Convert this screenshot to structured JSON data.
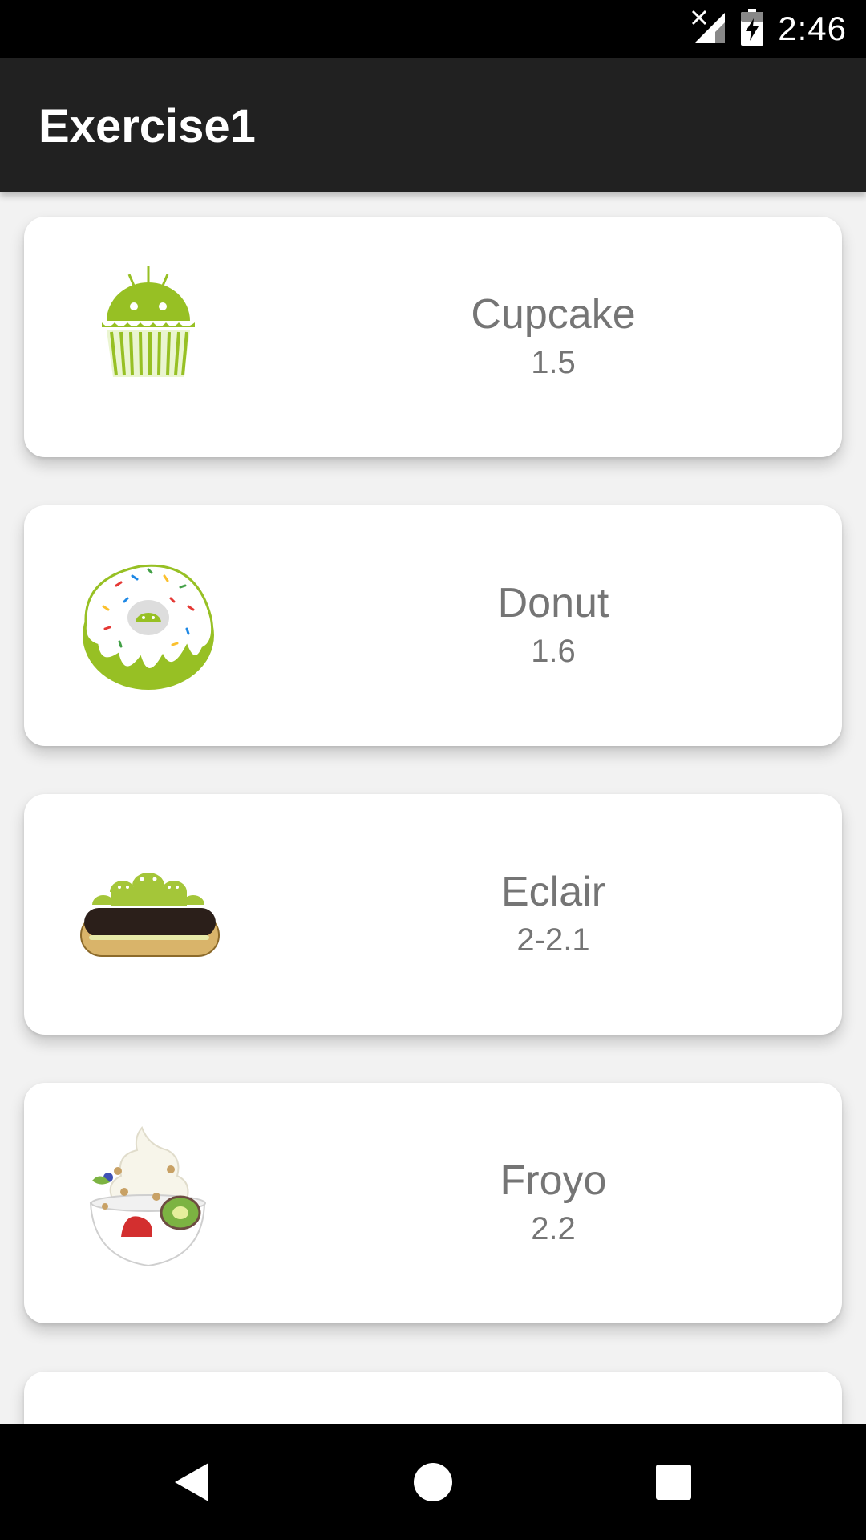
{
  "status_bar": {
    "time": "2:46",
    "icons": [
      "no-signal-icon",
      "battery-charging-icon"
    ]
  },
  "app_bar": {
    "title": "Exercise1"
  },
  "list": {
    "items": [
      {
        "name": "Cupcake",
        "version": "1.5",
        "icon": "cupcake-image"
      },
      {
        "name": "Donut",
        "version": "1.6",
        "icon": "donut-image"
      },
      {
        "name": "Eclair",
        "version": "2-2.1",
        "icon": "eclair-image"
      },
      {
        "name": "Froyo",
        "version": "2.2",
        "icon": "froyo-image"
      }
    ]
  },
  "nav_bar": {
    "buttons": [
      "back-icon",
      "home-icon",
      "recents-icon"
    ]
  },
  "colors": {
    "status_bar": "#000000",
    "app_bar": "#212121",
    "card_text": "#757575",
    "android_green": "#97c024"
  }
}
